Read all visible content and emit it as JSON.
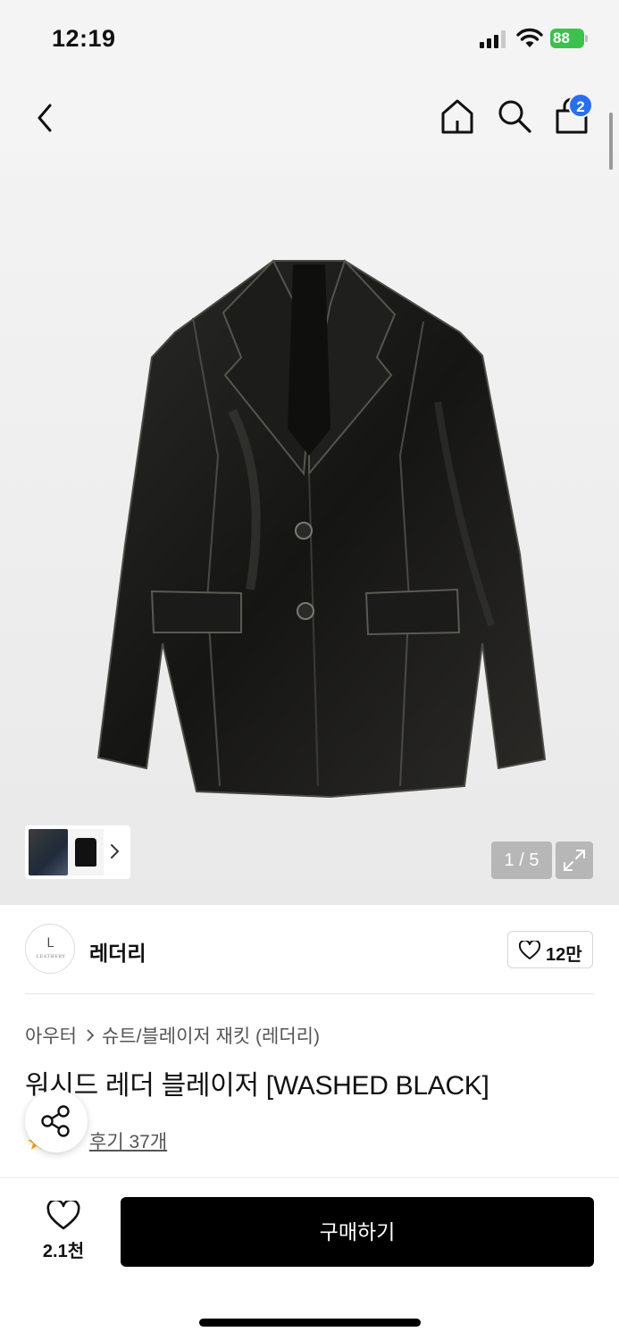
{
  "status_bar": {
    "time": "12:19",
    "battery": "88"
  },
  "header": {
    "back_icon": "chevron-left-icon",
    "home_icon": "home-icon",
    "search_icon": "search-icon",
    "cart_icon": "shopping-bag-icon",
    "cart_badge": "2"
  },
  "gallery": {
    "pager": "1 / 5",
    "expand_icon": "expand-icon"
  },
  "brand": {
    "name": "레더리",
    "like_count": "12만"
  },
  "product": {
    "breadcrumb": [
      "아우터",
      "슈트/블레이저 재킷 (레더리)"
    ],
    "title": "워시드 레더 블레이저 [WASHED BLACK]",
    "reviews": "후기 37개"
  },
  "bottom_bar": {
    "wish_count": "2.1천",
    "buy_label": "구매하기"
  },
  "colors": {
    "badge": "#2a6ef0",
    "battery": "#3cc14e",
    "buy_button": "#000000"
  }
}
